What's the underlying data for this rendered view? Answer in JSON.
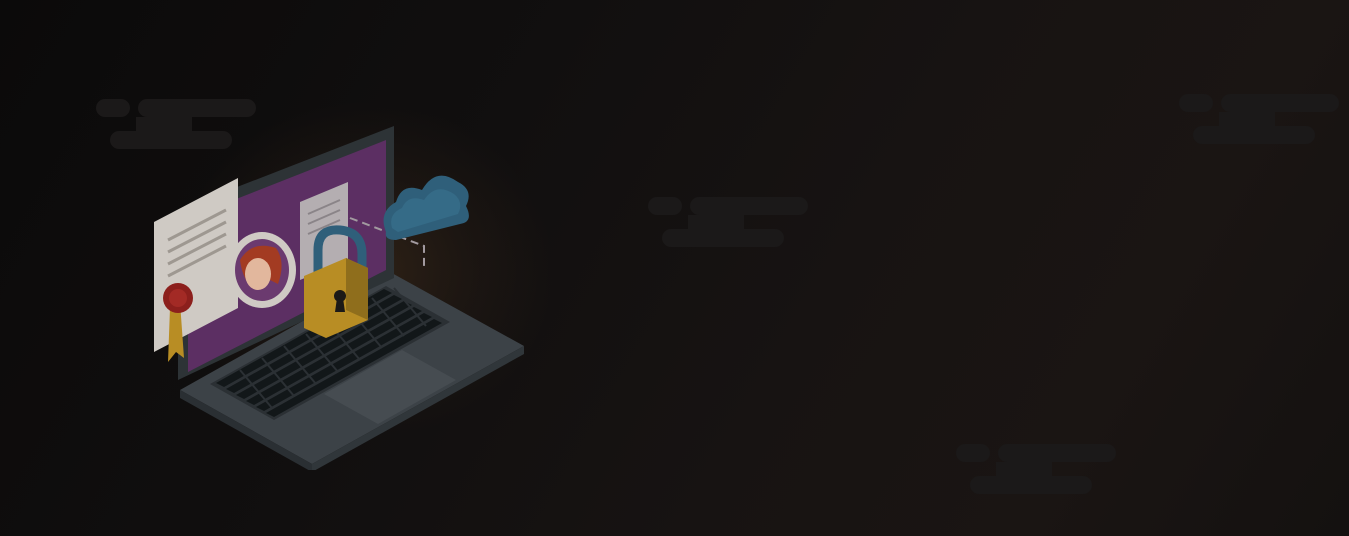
{
  "hero": {
    "illustration": "laptop-security-icon",
    "clouds": [
      "cloud-shape-1",
      "cloud-shape-2",
      "cloud-shape-3",
      "cloud-shape-4"
    ]
  },
  "colors": {
    "background": "#0c0b0b",
    "cloud": "#1b1919",
    "screen": "#5c2f63",
    "lock": "#b88d24",
    "cloud_icon": "#2f5f7a",
    "laptop_body": "#3c4247",
    "keys": "#121719"
  }
}
